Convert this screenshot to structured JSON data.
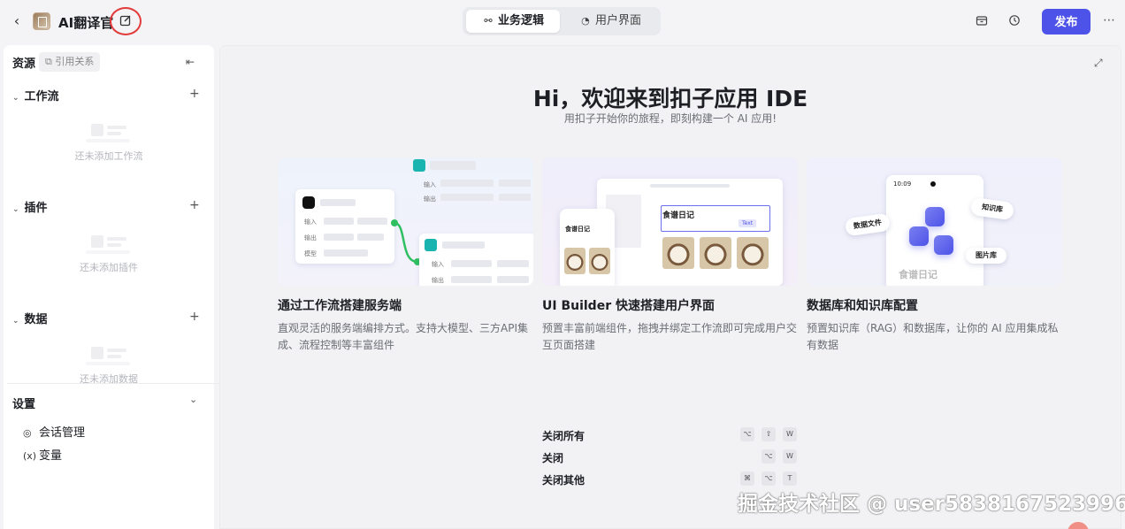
{
  "header": {
    "app_name": "AI翻译官",
    "tabs": [
      {
        "label": "业务逻辑",
        "icon": "workflow-icon",
        "active": true
      },
      {
        "label": "用户界面",
        "icon": "palette-icon",
        "active": false
      }
    ],
    "publish_label": "发布"
  },
  "sidebar": {
    "title": "资源",
    "ref_chip": "引用关系",
    "sections": [
      {
        "label": "工作流",
        "empty": "还未添加工作流"
      },
      {
        "label": "插件",
        "empty": "还未添加插件"
      },
      {
        "label": "数据",
        "empty": "还未添加数据"
      }
    ],
    "settings": {
      "label": "设置",
      "items": [
        {
          "label": "会话管理",
          "icon": "chat-manage-icon"
        },
        {
          "label": "变量",
          "icon": "variable-icon"
        }
      ]
    }
  },
  "main": {
    "hero_title": "Hi，欢迎来到扣子应用 IDE",
    "hero_subtitle": "用扣子开始你的旅程，即刻构建一个 AI 应用!",
    "cards": [
      {
        "title": "通过工作流搭建服务端",
        "desc": "直观灵活的服务端编排方式。支持大模型、三方API集成、流程控制等丰富组件"
      },
      {
        "title": "UI Builder 快速搭建用户界面",
        "desc": "预置丰富前端组件，拖拽并绑定工作流即可完成用户交互页面搭建"
      },
      {
        "title": "数据库和知识库配置",
        "desc": "预置知识库（RAG）和数据库，让你的 AI 应用集成私有数据"
      }
    ],
    "card1_illus": {
      "in1": "输入",
      "out1": "输出",
      "model": "模型",
      "in2": "输入",
      "out2": "输出",
      "in3": "输入",
      "out3": "输出"
    },
    "card2_illus": {
      "food1": "食谱日记",
      "food2": "食谱日记",
      "text_tag": "Text"
    },
    "card3_illus": {
      "time": "10:09",
      "tag1": "数据文件",
      "tag2": "知识库",
      "tag3": "图片库",
      "app": "食谱日记"
    },
    "shortcuts": [
      {
        "label": "关闭所有",
        "keys": [
          "⌥",
          "⇧",
          "W"
        ]
      },
      {
        "label": "关闭",
        "keys": [
          "⌥",
          "W"
        ]
      },
      {
        "label": "关闭其他",
        "keys": [
          "⌘",
          "⌥",
          "T"
        ]
      }
    ]
  },
  "watermark": "掘金技术社区 @ user5838167523996"
}
